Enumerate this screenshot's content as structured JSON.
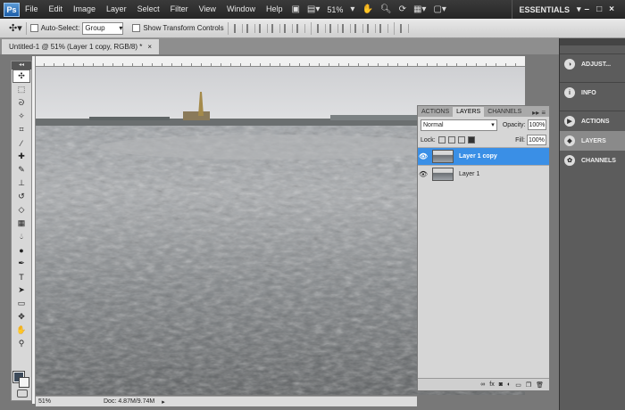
{
  "app": {
    "logo": "Ps"
  },
  "menus": [
    "File",
    "Edit",
    "Image",
    "Layer",
    "Select",
    "Filter",
    "View",
    "Window",
    "Help"
  ],
  "appbar": {
    "zoom": "51%",
    "workspace": "ESSENTIALS"
  },
  "options": {
    "auto_select_label": "Auto-Select:",
    "group_value": "Group",
    "show_transform_label": "Show Transform Controls"
  },
  "document": {
    "tab_title": "Untitled-1 @ 51% (Layer 1 copy, RGB/8) *",
    "tab_close": "×"
  },
  "status": {
    "zoom": "51%",
    "doc_size": "Doc: 4.87M/9.74M"
  },
  "layers_panel": {
    "tabs": [
      "ACTIONS",
      "LAYERS",
      "CHANNELS"
    ],
    "active_tab": "LAYERS",
    "blend_mode": "Normal",
    "opacity_label": "Opacity:",
    "opacity_value": "100%",
    "lock_label": "Lock:",
    "fill_label": "Fill:",
    "fill_value": "100%",
    "layers": [
      {
        "name": "Layer 1 copy",
        "selected": true
      },
      {
        "name": "Layer 1",
        "selected": false
      }
    ],
    "footer_icons": [
      "link-icon",
      "fx-icon",
      "mask-icon",
      "adjustment-icon",
      "group-icon",
      "new-layer-icon",
      "trash-icon"
    ]
  },
  "dock": {
    "items": [
      {
        "label": "ADJUST...",
        "icon": "adjustments-icon"
      },
      {
        "label": "INFO",
        "icon": "info-icon"
      },
      {
        "label": "ACTIONS",
        "icon": "actions-icon"
      },
      {
        "label": "LAYERS",
        "icon": "layers-icon"
      },
      {
        "label": "CHANNELS",
        "icon": "channels-icon"
      }
    ]
  },
  "colors": {
    "accent_selection": "#3a8fe6",
    "menubar": "#2d2d2d",
    "dock": "#5c5c5c"
  }
}
